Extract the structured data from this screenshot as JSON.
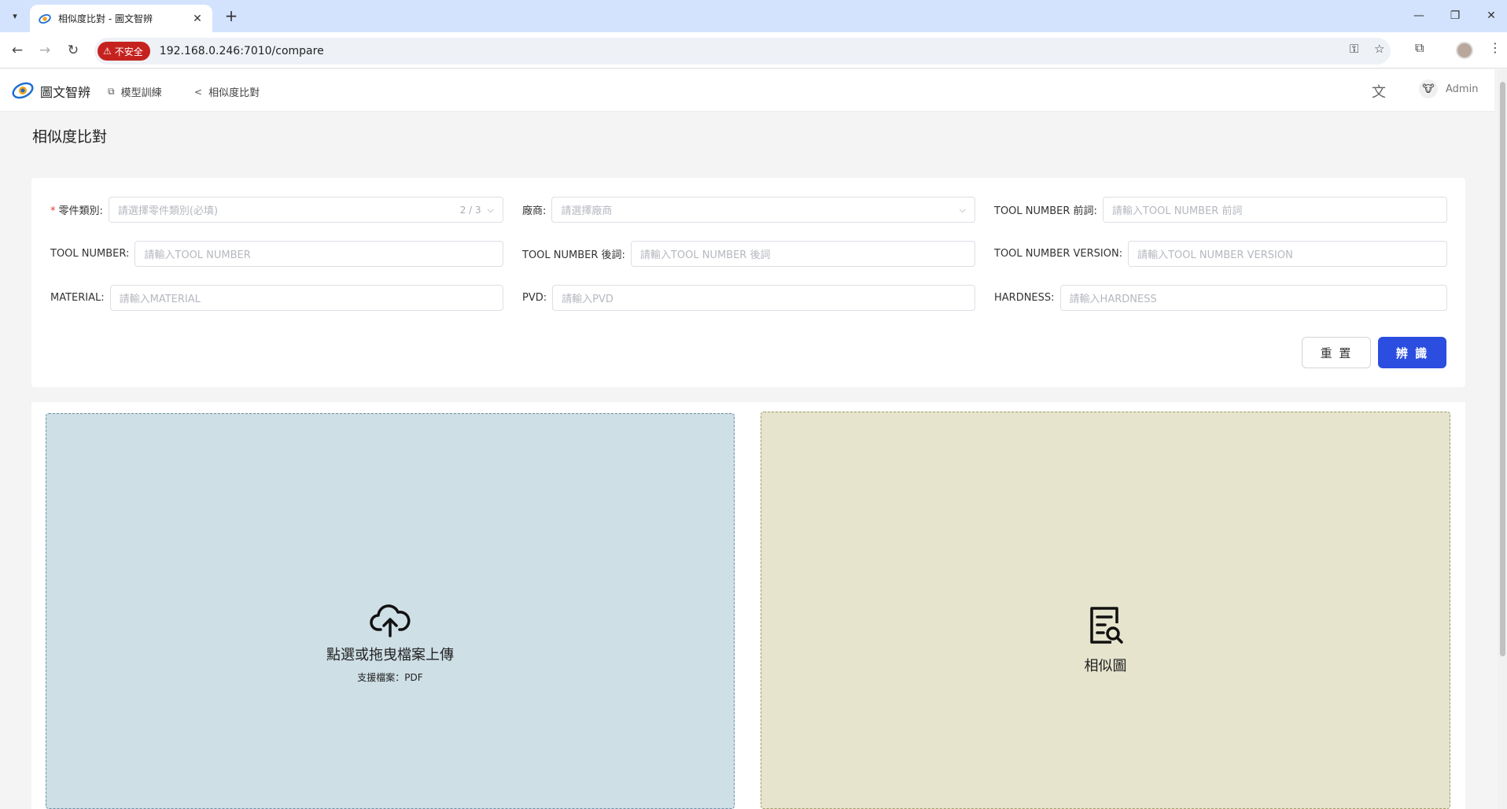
{
  "browser": {
    "tab_title": "相似度比對 - 圖文智辨",
    "new_tab_icon": "plus-icon",
    "insecure_label": "不安全",
    "url": "192.168.0.246:7010/compare"
  },
  "header": {
    "brand": "圖文智辨",
    "menu": [
      {
        "label": "模型訓練",
        "icon": "copy-icon"
      },
      {
        "label": "相似度比對",
        "icon": "share-icon"
      }
    ],
    "user": "Admin"
  },
  "page": {
    "title": "相似度比對"
  },
  "form": {
    "part_category": {
      "label": "零件類別:",
      "placeholder": "請選擇零件類別(必填)",
      "count": "2 / 3",
      "required": true
    },
    "vendor": {
      "label": "廠商:",
      "placeholder": "請選擇廠商"
    },
    "tool_number_prefix": {
      "label": "TOOL NUMBER 前詞:",
      "placeholder": "請輸入TOOL NUMBER 前詞"
    },
    "tool_number": {
      "label": "TOOL NUMBER:",
      "placeholder": "請輸入TOOL NUMBER"
    },
    "tool_number_suffix": {
      "label": "TOOL NUMBER 後詞:",
      "placeholder": "請輸入TOOL NUMBER 後詞"
    },
    "tool_number_version": {
      "label": "TOOL NUMBER VERSION:",
      "placeholder": "請輸入TOOL NUMBER VERSION"
    },
    "material": {
      "label": "MATERIAL:",
      "placeholder": "請輸入MATERIAL"
    },
    "pvd": {
      "label": "PVD:",
      "placeholder": "請輸入PVD"
    },
    "hardness": {
      "label": "HARDNESS:",
      "placeholder": "請輸入HARDNESS"
    },
    "reset_label": "重 置",
    "identify_label": "辨 識"
  },
  "upload": {
    "text": "點選或拖曳檔案上傳",
    "hint": "支援檔案：PDF"
  },
  "result": {
    "text": "相似圖"
  },
  "colors": {
    "primary": "#2b4de0",
    "upload_bg": "#cedfe6",
    "result_bg": "#e6e4cd",
    "insecure": "#c5221f",
    "required": "#e53935"
  }
}
